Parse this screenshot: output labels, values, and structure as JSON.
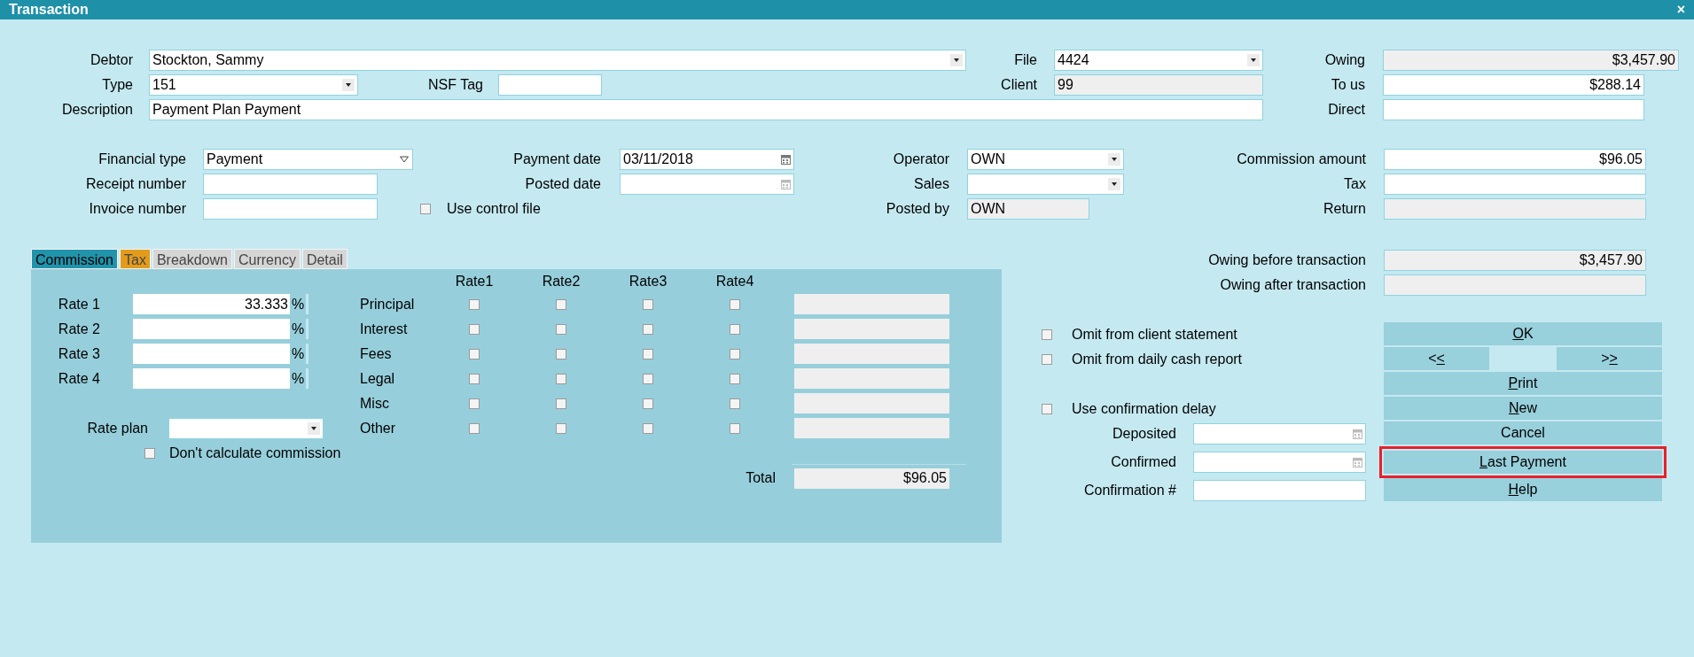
{
  "window": {
    "title": "Transaction",
    "close": "×"
  },
  "fields": {
    "debtor": {
      "label": "Debtor",
      "value": "Stockton, Sammy",
      "kind": "dropdown",
      "readonly": false
    },
    "file": {
      "label": "File",
      "value": "4424",
      "kind": "dropdown",
      "readonly": false
    },
    "owing": {
      "label": "Owing",
      "value": "$3,457.90",
      "kind": "amount",
      "readonly": true
    },
    "type": {
      "label": "Type",
      "value": "151",
      "kind": "dropdown",
      "readonly": false
    },
    "nsf_tag": {
      "label": "NSF Tag",
      "readonly": false
    },
    "client": {
      "label": "Client",
      "value": "99",
      "readonly": true
    },
    "to_us": {
      "label": "To us",
      "value": "$288.14",
      "kind": "amount",
      "readonly": false
    },
    "description": {
      "label": "Description",
      "value": "Payment Plan Payment",
      "readonly": false
    },
    "direct": {
      "label": "Direct",
      "readonly": false
    },
    "financial_type": {
      "label": "Financial type",
      "value": "Payment",
      "kind": "select",
      "readonly": false
    },
    "payment_date": {
      "label": "Payment date",
      "value": "03/11/2018",
      "kind": "date",
      "readonly": false
    },
    "operator": {
      "label": "Operator",
      "value": "OWN",
      "kind": "dropdown",
      "readonly": false
    },
    "commission_amount": {
      "label": "Commission amount",
      "value": "$96.05",
      "kind": "amount",
      "readonly": false
    },
    "receipt_number": {
      "label": "Receipt number",
      "readonly": false
    },
    "posted_date": {
      "label": "Posted date",
      "kind": "date",
      "readonly": false
    },
    "sales": {
      "label": "Sales",
      "kind": "dropdown",
      "readonly": false
    },
    "tax": {
      "label": "Tax",
      "readonly": false
    },
    "invoice_number": {
      "label": "Invoice number",
      "readonly": false
    },
    "posted_by": {
      "label": "Posted by",
      "value": "OWN",
      "readonly": true
    },
    "return": {
      "label": "Return",
      "readonly": true
    },
    "owing_before": {
      "label": "Owing before transaction",
      "value": "$3,457.90",
      "kind": "amount",
      "readonly": true
    },
    "owing_after": {
      "label": "Owing after transaction",
      "readonly": true
    },
    "deposited": {
      "label": "Deposited",
      "kind": "date",
      "readonly": false
    },
    "confirmed": {
      "label": "Confirmed",
      "kind": "date",
      "readonly": false
    },
    "confirmation_number": {
      "label": "Confirmation #",
      "readonly": false
    }
  },
  "use_control_file": {
    "label": "Use control file",
    "checked": false
  },
  "tabs": [
    {
      "label": "Commission",
      "selected": true,
      "color": "#2193ab"
    },
    {
      "label": "Tax",
      "selected": false,
      "color": "#e39b1c"
    },
    {
      "label": "Breakdown",
      "selected": false,
      "color": "#d6d6d6"
    },
    {
      "label": "Currency",
      "selected": false,
      "color": "#d6d6d6"
    },
    {
      "label": "Detail",
      "selected": false,
      "color": "#d6d6d6"
    }
  ],
  "commission": {
    "rates": [
      {
        "label": "Rate 1",
        "value": "33.333",
        "unit": "%"
      },
      {
        "label": "Rate 2",
        "unit": "%"
      },
      {
        "label": "Rate 3",
        "unit": "%"
      },
      {
        "label": "Rate 4",
        "unit": "%"
      }
    ],
    "rate_columns": [
      "Rate1",
      "Rate2",
      "Rate3",
      "Rate4"
    ],
    "categories": [
      {
        "label": "Principal",
        "checks": [
          false,
          false,
          false,
          false
        ]
      },
      {
        "label": "Interest",
        "checks": [
          false,
          false,
          false,
          false
        ]
      },
      {
        "label": "Fees",
        "checks": [
          false,
          false,
          false,
          false
        ]
      },
      {
        "label": "Legal",
        "checks": [
          false,
          false,
          false,
          false
        ]
      },
      {
        "label": "Misc",
        "checks": [
          false,
          false,
          false,
          false
        ]
      },
      {
        "label": "Other",
        "checks": [
          false,
          false,
          false,
          false
        ]
      }
    ],
    "rate_plan": {
      "label": "Rate plan"
    },
    "dont_calculate": {
      "label": "Don't calculate commission",
      "checked": false
    },
    "total": {
      "label": "Total",
      "value": "$96.05"
    }
  },
  "options": [
    {
      "label": "Omit from client statement",
      "checked": false
    },
    {
      "label": "Omit from daily cash report",
      "checked": false
    },
    {
      "label": "Use confirmation delay",
      "checked": false
    }
  ],
  "buttons": [
    {
      "kind": "single",
      "label": {
        "key": "O",
        "after": "K"
      },
      "highlighted": false
    },
    {
      "kind": "pair",
      "left": {
        "before": "<",
        "key": "<"
      },
      "right": {
        "before": ">",
        "key": ">"
      },
      "highlighted": false
    },
    {
      "kind": "single",
      "label": {
        "key": "P",
        "after": "rint"
      },
      "highlighted": false
    },
    {
      "kind": "single",
      "label": {
        "key": "N",
        "after": "ew"
      },
      "highlighted": false
    },
    {
      "kind": "single",
      "label": {
        "before": "Cancel"
      },
      "highlighted": false
    },
    {
      "kind": "single",
      "label": {
        "key": "L",
        "after": "ast Payment"
      },
      "highlighted": true
    },
    {
      "kind": "single",
      "label": {
        "key": "H",
        "after": "elp"
      },
      "highlighted": false
    }
  ]
}
